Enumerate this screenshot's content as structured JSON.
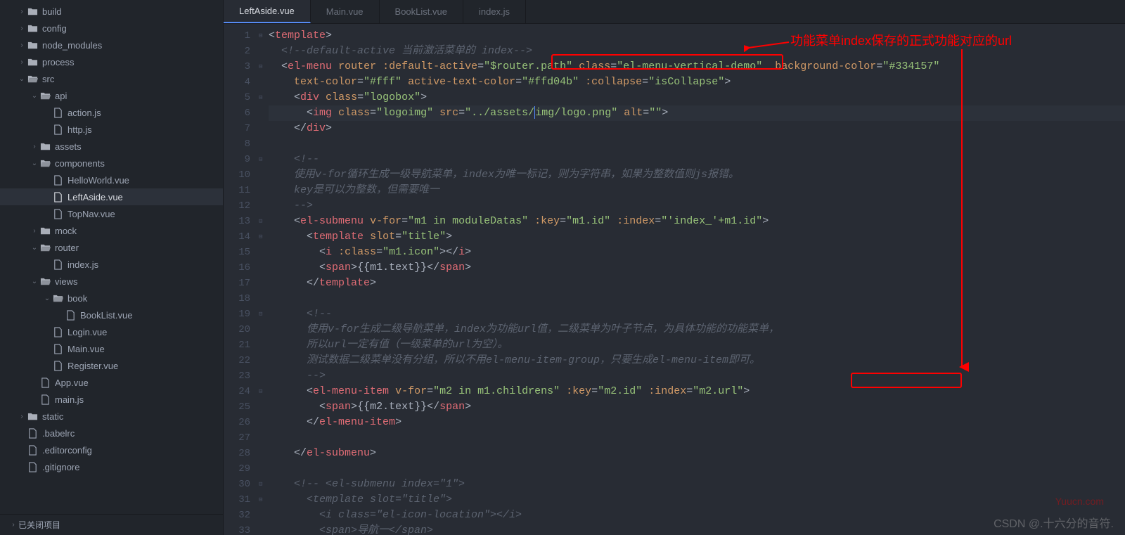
{
  "tree": [
    {
      "depth": 0,
      "arrow": "›",
      "icon": "folder",
      "label": "build"
    },
    {
      "depth": 0,
      "arrow": "›",
      "icon": "folder",
      "label": "config"
    },
    {
      "depth": 0,
      "arrow": "›",
      "icon": "folder",
      "label": "node_modules"
    },
    {
      "depth": 0,
      "arrow": "›",
      "icon": "folder",
      "label": "process"
    },
    {
      "depth": 0,
      "arrow": "⌄",
      "icon": "folder-open",
      "label": "src"
    },
    {
      "depth": 1,
      "arrow": "⌄",
      "icon": "folder-open",
      "label": "api"
    },
    {
      "depth": 2,
      "arrow": "",
      "icon": "file",
      "label": "action.js"
    },
    {
      "depth": 2,
      "arrow": "",
      "icon": "file",
      "label": "http.js"
    },
    {
      "depth": 1,
      "arrow": "›",
      "icon": "folder",
      "label": "assets"
    },
    {
      "depth": 1,
      "arrow": "⌄",
      "icon": "folder-open",
      "label": "components"
    },
    {
      "depth": 2,
      "arrow": "",
      "icon": "file",
      "label": "HelloWorld.vue"
    },
    {
      "depth": 2,
      "arrow": "",
      "icon": "file",
      "label": "LeftAside.vue",
      "active": true
    },
    {
      "depth": 2,
      "arrow": "",
      "icon": "file",
      "label": "TopNav.vue"
    },
    {
      "depth": 1,
      "arrow": "›",
      "icon": "folder",
      "label": "mock"
    },
    {
      "depth": 1,
      "arrow": "⌄",
      "icon": "folder-open",
      "label": "router"
    },
    {
      "depth": 2,
      "arrow": "",
      "icon": "file",
      "label": "index.js"
    },
    {
      "depth": 1,
      "arrow": "⌄",
      "icon": "folder-open",
      "label": "views"
    },
    {
      "depth": 2,
      "arrow": "⌄",
      "icon": "folder-open",
      "label": "book"
    },
    {
      "depth": 3,
      "arrow": "",
      "icon": "file",
      "label": "BookList.vue"
    },
    {
      "depth": 2,
      "arrow": "",
      "icon": "file",
      "label": "Login.vue"
    },
    {
      "depth": 2,
      "arrow": "",
      "icon": "file",
      "label": "Main.vue"
    },
    {
      "depth": 2,
      "arrow": "",
      "icon": "file",
      "label": "Register.vue"
    },
    {
      "depth": 1,
      "arrow": "",
      "icon": "file",
      "label": "App.vue"
    },
    {
      "depth": 1,
      "arrow": "",
      "icon": "file",
      "label": "main.js"
    },
    {
      "depth": 0,
      "arrow": "›",
      "icon": "folder",
      "label": "static"
    },
    {
      "depth": 0,
      "arrow": "",
      "icon": "file",
      "label": ".babelrc"
    },
    {
      "depth": 0,
      "arrow": "",
      "icon": "file",
      "label": ".editorconfig"
    },
    {
      "depth": 0,
      "arrow": "",
      "icon": "file",
      "label": ".gitignore"
    }
  ],
  "closed_projects": "已关闭项目",
  "tabs": [
    {
      "label": "LeftAside.vue",
      "active": true
    },
    {
      "label": "Main.vue"
    },
    {
      "label": "BookList.vue"
    },
    {
      "label": "index.js"
    }
  ],
  "gutter": [
    "1",
    "2",
    "3",
    "4",
    "5",
    "6",
    "7",
    "8",
    "9",
    "10",
    "11",
    "12",
    "13",
    "14",
    "15",
    "16",
    "17",
    "18",
    "19",
    "20",
    "21",
    "22",
    "23",
    "24",
    "25",
    "26",
    "27",
    "28",
    "29",
    "30",
    "31",
    "32",
    "33"
  ],
  "fold": [
    "⊟",
    "",
    "⊟",
    "",
    "⊟",
    "",
    "",
    "",
    "⊟",
    "",
    "",
    "",
    "⊟",
    "⊟",
    "",
    "",
    "",
    "",
    "⊟",
    "",
    "",
    "",
    "",
    "⊟",
    "",
    "",
    "",
    "",
    "",
    "⊟",
    "⊟",
    "",
    ""
  ],
  "code_lines": [
    {
      "h": [
        [
          "pun",
          "<"
        ],
        [
          "tag",
          "template"
        ],
        [
          "pun",
          ">"
        ]
      ]
    },
    {
      "h": [
        [
          "txt",
          "  "
        ],
        [
          "cmt",
          "<!--default-active 当前激活菜单的 index-->"
        ]
      ]
    },
    {
      "h": [
        [
          "txt",
          "  "
        ],
        [
          "pun",
          "<"
        ],
        [
          "tag",
          "el-menu"
        ],
        [
          "txt",
          " "
        ],
        [
          "attr",
          "router"
        ],
        [
          "txt",
          " "
        ],
        [
          "attr",
          ":default-active"
        ],
        [
          "pun",
          "="
        ],
        [
          "str",
          "\"$router.path\""
        ],
        [
          "txt",
          " "
        ],
        [
          "attr",
          "class"
        ],
        [
          "pun",
          "="
        ],
        [
          "str",
          "\"el-menu-vertical-demo\""
        ],
        [
          "txt",
          "  "
        ],
        [
          "attr",
          "background-color"
        ],
        [
          "pun",
          "="
        ],
        [
          "str",
          "\"#334157\""
        ]
      ]
    },
    {
      "h": [
        [
          "txt",
          "    "
        ],
        [
          "attr",
          "text-color"
        ],
        [
          "pun",
          "="
        ],
        [
          "str",
          "\"#fff\""
        ],
        [
          "txt",
          " "
        ],
        [
          "attr",
          "active-text-color"
        ],
        [
          "pun",
          "="
        ],
        [
          "str",
          "\"#ffd04b\""
        ],
        [
          "txt",
          " "
        ],
        [
          "attr",
          ":collapse"
        ],
        [
          "pun",
          "="
        ],
        [
          "str",
          "\"isCollapse\""
        ],
        [
          "pun",
          ">"
        ]
      ]
    },
    {
      "h": [
        [
          "txt",
          "    "
        ],
        [
          "pun",
          "<"
        ],
        [
          "tag",
          "div"
        ],
        [
          "txt",
          " "
        ],
        [
          "attr",
          "class"
        ],
        [
          "pun",
          "="
        ],
        [
          "str",
          "\"logobox\""
        ],
        [
          "pun",
          ">"
        ]
      ]
    },
    {
      "hl": true,
      "h": [
        [
          "txt",
          "      "
        ],
        [
          "pun",
          "<"
        ],
        [
          "tag",
          "img"
        ],
        [
          "txt",
          " "
        ],
        [
          "attr",
          "class"
        ],
        [
          "pun",
          "="
        ],
        [
          "str",
          "\"logoimg\""
        ],
        [
          "txt",
          " "
        ],
        [
          "attr",
          "src"
        ],
        [
          "pun",
          "="
        ],
        [
          "str",
          "\"../assets/"
        ],
        [
          "cursor",
          ""
        ],
        [
          "str",
          "img/logo.png\""
        ],
        [
          "txt",
          " "
        ],
        [
          "attr",
          "alt"
        ],
        [
          "pun",
          "="
        ],
        [
          "str",
          "\"\""
        ],
        [
          "pun",
          ">"
        ]
      ]
    },
    {
      "h": [
        [
          "txt",
          "    "
        ],
        [
          "pun",
          "</"
        ],
        [
          "tag",
          "div"
        ],
        [
          "pun",
          ">"
        ]
      ]
    },
    {
      "h": [
        [
          "txt",
          ""
        ]
      ]
    },
    {
      "h": [
        [
          "txt",
          "    "
        ],
        [
          "cmt",
          "<!--"
        ]
      ]
    },
    {
      "h": [
        [
          "txt",
          "    "
        ],
        [
          "cmt",
          "使用v-for循环生成一级导航菜单，index为唯一标记，则为字符串，如果为整数值则js报错。"
        ]
      ]
    },
    {
      "h": [
        [
          "txt",
          "    "
        ],
        [
          "cmt",
          "key是可以为整数，但需要唯一"
        ]
      ]
    },
    {
      "h": [
        [
          "txt",
          "    "
        ],
        [
          "cmt",
          "-->"
        ]
      ]
    },
    {
      "h": [
        [
          "txt",
          "    "
        ],
        [
          "pun",
          "<"
        ],
        [
          "tag",
          "el-submenu"
        ],
        [
          "txt",
          " "
        ],
        [
          "attr",
          "v-for"
        ],
        [
          "pun",
          "="
        ],
        [
          "str",
          "\"m1 in moduleDatas\""
        ],
        [
          "txt",
          " "
        ],
        [
          "attr",
          ":key"
        ],
        [
          "pun",
          "="
        ],
        [
          "str",
          "\"m1.id\""
        ],
        [
          "txt",
          " "
        ],
        [
          "attr",
          ":index"
        ],
        [
          "pun",
          "="
        ],
        [
          "str",
          "\"'index_'+m1.id\""
        ],
        [
          "pun",
          ">"
        ]
      ]
    },
    {
      "h": [
        [
          "txt",
          "      "
        ],
        [
          "pun",
          "<"
        ],
        [
          "tag",
          "template"
        ],
        [
          "txt",
          " "
        ],
        [
          "attr",
          "slot"
        ],
        [
          "pun",
          "="
        ],
        [
          "str",
          "\"title\""
        ],
        [
          "pun",
          ">"
        ]
      ]
    },
    {
      "h": [
        [
          "txt",
          "        "
        ],
        [
          "pun",
          "<"
        ],
        [
          "tag",
          "i"
        ],
        [
          "txt",
          " "
        ],
        [
          "attr",
          ":class"
        ],
        [
          "pun",
          "="
        ],
        [
          "str",
          "\"m1.icon\""
        ],
        [
          "pun",
          "></"
        ],
        [
          "tag",
          "i"
        ],
        [
          "pun",
          ">"
        ]
      ]
    },
    {
      "h": [
        [
          "txt",
          "        "
        ],
        [
          "pun",
          "<"
        ],
        [
          "tag",
          "span"
        ],
        [
          "pun",
          ">"
        ],
        [
          "txt",
          "{{m1.text}}"
        ],
        [
          "pun",
          "</"
        ],
        [
          "tag",
          "span"
        ],
        [
          "pun",
          ">"
        ]
      ]
    },
    {
      "h": [
        [
          "txt",
          "      "
        ],
        [
          "pun",
          "</"
        ],
        [
          "tag",
          "template"
        ],
        [
          "pun",
          ">"
        ]
      ]
    },
    {
      "h": [
        [
          "txt",
          ""
        ]
      ]
    },
    {
      "h": [
        [
          "txt",
          "      "
        ],
        [
          "cmt",
          "<!--"
        ]
      ]
    },
    {
      "h": [
        [
          "txt",
          "      "
        ],
        [
          "cmt",
          "使用v-for生成二级导航菜单，index为功能url值，二级菜单为叶子节点，为具体功能的功能菜单，"
        ]
      ]
    },
    {
      "h": [
        [
          "txt",
          "      "
        ],
        [
          "cmt",
          "所以url一定有值（一级菜单的url为空）。"
        ]
      ]
    },
    {
      "h": [
        [
          "txt",
          "      "
        ],
        [
          "cmt",
          "测试数据二级菜单没有分组，所以不用el-menu-item-group，只要生成el-menu-item即可。"
        ]
      ]
    },
    {
      "h": [
        [
          "txt",
          "      "
        ],
        [
          "cmt",
          "-->"
        ]
      ]
    },
    {
      "h": [
        [
          "txt",
          "      "
        ],
        [
          "pun",
          "<"
        ],
        [
          "tag",
          "el-menu-item"
        ],
        [
          "txt",
          " "
        ],
        [
          "attr",
          "v-for"
        ],
        [
          "pun",
          "="
        ],
        [
          "str",
          "\"m2 in m1.childrens\""
        ],
        [
          "txt",
          " "
        ],
        [
          "attr",
          ":key"
        ],
        [
          "pun",
          "="
        ],
        [
          "str",
          "\"m2.id\""
        ],
        [
          "txt",
          " "
        ],
        [
          "attr",
          ":index"
        ],
        [
          "pun",
          "="
        ],
        [
          "str",
          "\"m2.url\""
        ],
        [
          "pun",
          ">"
        ]
      ]
    },
    {
      "h": [
        [
          "txt",
          "        "
        ],
        [
          "pun",
          "<"
        ],
        [
          "tag",
          "span"
        ],
        [
          "pun",
          ">"
        ],
        [
          "txt",
          "{{m2.text}}"
        ],
        [
          "pun",
          "</"
        ],
        [
          "tag",
          "span"
        ],
        [
          "pun",
          ">"
        ]
      ]
    },
    {
      "h": [
        [
          "txt",
          "      "
        ],
        [
          "pun",
          "</"
        ],
        [
          "tag",
          "el-menu-item"
        ],
        [
          "pun",
          ">"
        ]
      ]
    },
    {
      "h": [
        [
          "txt",
          ""
        ]
      ]
    },
    {
      "h": [
        [
          "txt",
          "    "
        ],
        [
          "pun",
          "</"
        ],
        [
          "tag",
          "el-submenu"
        ],
        [
          "pun",
          ">"
        ]
      ]
    },
    {
      "h": [
        [
          "txt",
          ""
        ]
      ]
    },
    {
      "h": [
        [
          "txt",
          "    "
        ],
        [
          "cmt",
          "<!-- <el-submenu index=\"1\">"
        ]
      ]
    },
    {
      "h": [
        [
          "txt",
          "      "
        ],
        [
          "cmt",
          "<template slot=\"title\">"
        ]
      ]
    },
    {
      "h": [
        [
          "txt",
          "        "
        ],
        [
          "cmt",
          "<i class=\"el-icon-location\"></i>"
        ]
      ]
    },
    {
      "h": [
        [
          "txt",
          "        "
        ],
        [
          "cmt",
          "<span>导航一</span>"
        ]
      ]
    }
  ],
  "annotation_text": "功能菜单index保存的正式功能对应的url",
  "watermark_bottom": "CSDN @.十六分的音符.",
  "watermark_side": "Yuucn.com"
}
